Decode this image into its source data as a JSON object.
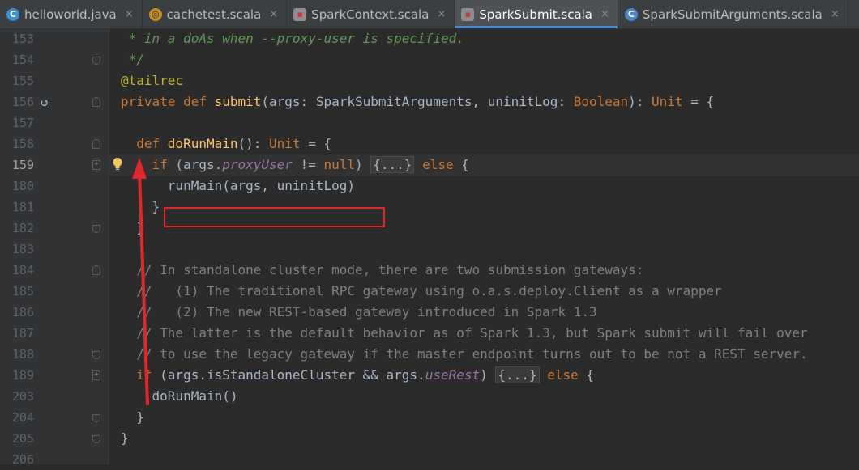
{
  "tabs": [
    {
      "label": "helloworld.java",
      "icon": "java-class-icon",
      "icon_glyph": "C",
      "active": false
    },
    {
      "label": "cachetest.scala",
      "icon": "scala-object-icon",
      "icon_glyph": "◎",
      "active": false
    },
    {
      "label": "SparkContext.scala",
      "icon": "scala-class-icon",
      "icon_glyph": "▪",
      "active": false
    },
    {
      "label": "SparkSubmit.scala",
      "icon": "scala-class-icon",
      "icon_glyph": "▪",
      "active": true
    },
    {
      "label": "SparkSubmitArguments.scala",
      "icon": "scala-class-icon",
      "icon_glyph": "C",
      "active": false
    }
  ],
  "close_glyph": "×",
  "lines": [
    {
      "n": "153",
      "html": "<span class='cm'> * in a doAs when --proxy-user is specified.</span>"
    },
    {
      "n": "154",
      "html": "<span class='cm'> */</span>"
    },
    {
      "n": "155",
      "html": "<span class='ann'>@tailrec</span>"
    },
    {
      "n": "156",
      "html": "<span class='kw'>private def </span><span class='fn'>submit</span>(args: SparkSubmitArguments, uninitLog: <span class='ty'>Boolean</span>): <span class='ty'>Unit</span> = {"
    },
    {
      "n": "157",
      "html": ""
    },
    {
      "n": "158",
      "html": "  <span class='kw'>def </span><span class='fn'>doRunMain</span>(): <span class='ty'>Unit</span> = {"
    },
    {
      "n": "159",
      "html": "    <span class='kw'>if</span> (args.<span class='fld'>proxyUser</span> != <span class='kw'>null</span>) <span class='fold-ph'>{...}</span> <span class='kw'>else</span> {"
    },
    {
      "n": "180",
      "html": "      runMain(args, uninitLog)"
    },
    {
      "n": "181",
      "html": "    }"
    },
    {
      "n": "182",
      "html": "  }"
    },
    {
      "n": "183",
      "html": ""
    },
    {
      "n": "184",
      "html": "  <span class='cm2'>// In standalone cluster mode, there are two submission gateways:</span>"
    },
    {
      "n": "185",
      "html": "  <span class='cm2'>//   (1) The traditional RPC gateway using o.a.s.deploy.Client as a wrapper</span>"
    },
    {
      "n": "186",
      "html": "  <span class='cm2'>//   (2) The new REST-based gateway introduced in Spark 1.3</span>"
    },
    {
      "n": "187",
      "html": "  <span class='cm2'>// The latter is the default behavior as of Spark 1.3, but Spark submit will fail over</span>"
    },
    {
      "n": "188",
      "html": "  <span class='cm2'>// to use the legacy gateway if the master endpoint turns out to be not a REST server.</span>"
    },
    {
      "n": "189",
      "html": "  <span class='kw'>if</span> (args.isStandaloneCluster &amp;&amp; args.<span class='fld'>useRest</span>) <span class='fold-ph'>{...}</span> <span class='kw'>else</span> {"
    },
    {
      "n": "203",
      "html": "    doRunMain()"
    },
    {
      "n": "204",
      "html": "  }"
    },
    {
      "n": "205",
      "html": "}"
    },
    {
      "n": "206",
      "html": ""
    }
  ],
  "current_line_index": 6,
  "fold_markers": {
    "1": "end",
    "3": "start",
    "5": "start",
    "6": "plus",
    "9": "end",
    "11": "start",
    "15": "end",
    "16": "plus",
    "18": "end",
    "19": "end"
  },
  "colors": {
    "annotation_box": "#e0282a",
    "arrow": "#e0282a",
    "accent": "#4a88c7"
  }
}
